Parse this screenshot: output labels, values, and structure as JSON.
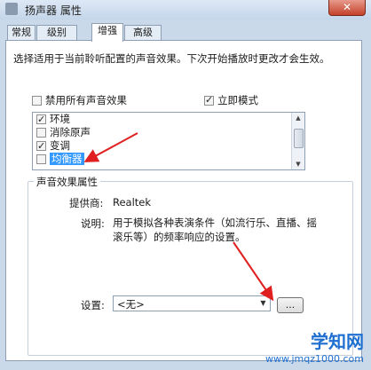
{
  "window": {
    "title": "扬声器 属性",
    "close_label": "✕"
  },
  "tabs": [
    {
      "label": "常规",
      "active": false
    },
    {
      "label": "级别",
      "active": false
    },
    {
      "label": "增强",
      "active": true
    },
    {
      "label": "高级",
      "active": false
    }
  ],
  "description": "选择适用于当前聆听配置的声音效果。下次开始播放时更改才会生效。",
  "options": {
    "disable_all": {
      "label": "禁用所有声音效果",
      "checked": false
    },
    "immediate_mode": {
      "label": "立即模式",
      "checked": true
    }
  },
  "effects_list": [
    {
      "label": "环境",
      "checked": true,
      "selected": false
    },
    {
      "label": "消除原声",
      "checked": false,
      "selected": false
    },
    {
      "label": "变调",
      "checked": true,
      "selected": false
    },
    {
      "label": "均衡器",
      "checked": false,
      "selected": true
    }
  ],
  "properties": {
    "group_title": "声音效果属性",
    "provider_label": "提供商:",
    "provider_value": "Realtek",
    "desc_label": "说明:",
    "desc_value": "用于模拟各种表演条件（如流行乐、直播、摇滚乐等）的频率响应的设置。",
    "settings_label": "设置:",
    "settings_value": "<无>",
    "settings_button": "..."
  },
  "watermark": {
    "title": "学知网",
    "url": "www.jmqz1000.com"
  },
  "colors": {
    "selection": "#3399ff",
    "annotation_arrow": "#e02020"
  }
}
